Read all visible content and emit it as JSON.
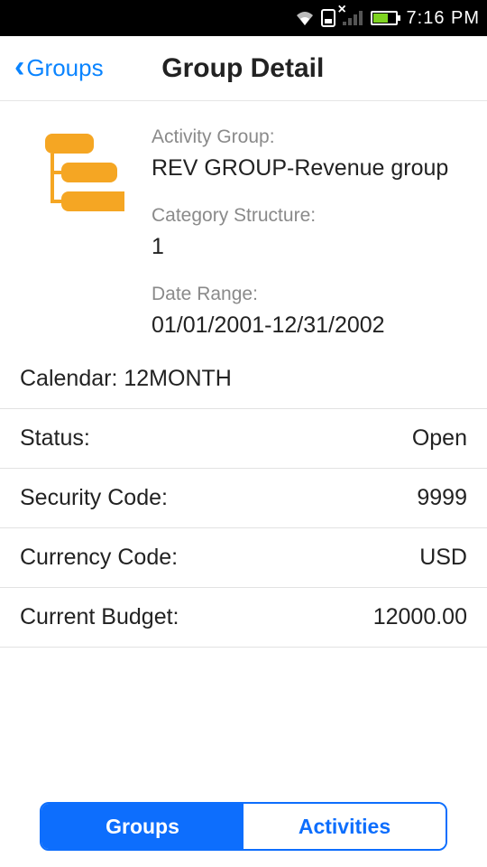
{
  "status_bar": {
    "time": "7:16 PM"
  },
  "nav": {
    "back_label": "Groups",
    "title": "Group Detail"
  },
  "hero": {
    "activity_group_label": "Activity Group:",
    "activity_group_value": "REV GROUP-Revenue group",
    "category_structure_label": "Category Structure:",
    "category_structure_value": "1",
    "date_range_label": "Date Range:",
    "date_range_value": "01/01/2001-12/31/2002"
  },
  "calendar": {
    "label": "Calendar:",
    "value": "12MONTH"
  },
  "rows": {
    "status": {
      "label": "Status:",
      "value": "Open"
    },
    "security": {
      "label": "Security Code:",
      "value": "9999"
    },
    "currency": {
      "label": "Currency Code:",
      "value": "USD"
    },
    "budget": {
      "label": "Current Budget:",
      "value": "12000.00"
    }
  },
  "tabs": {
    "groups": "Groups",
    "activities": "Activities"
  }
}
